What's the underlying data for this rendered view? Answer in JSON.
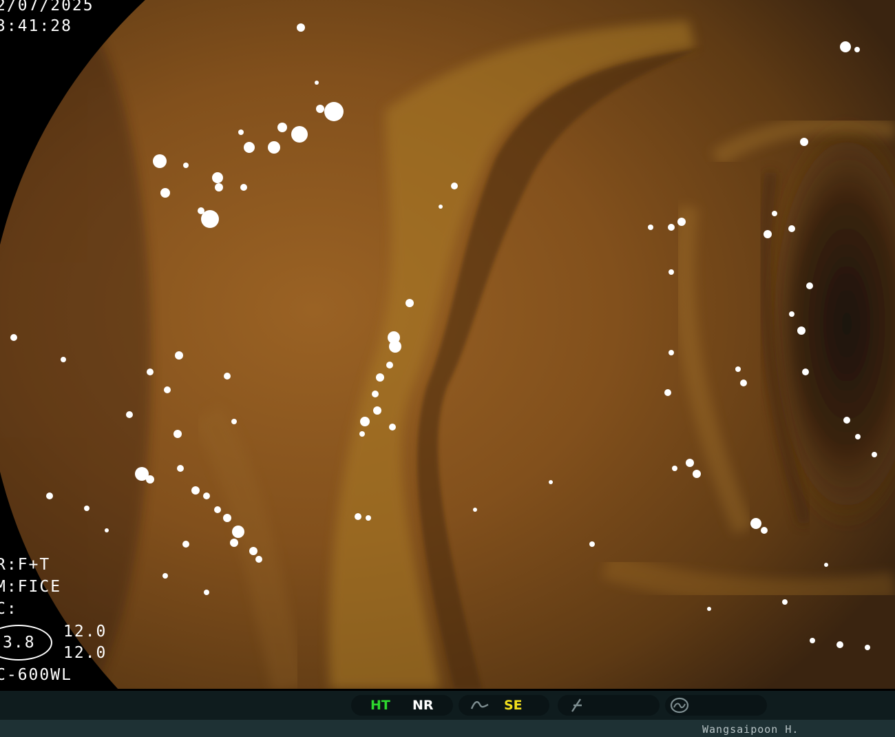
{
  "overlay": {
    "date": "2/07/2025",
    "time": "3:41:28",
    "mode_r": "R:F+T",
    "mode_m": "M:FICE",
    "mode_c": "C:",
    "oval_value": "3.8",
    "value_top": "12.0",
    "value_bottom": "12.0",
    "model": "C-600WL"
  },
  "status_bar": {
    "ht": "HT",
    "nr": "NR",
    "se": "SE",
    "icons": [
      "curve-icon",
      "slash-f-icon",
      "gauge-icon"
    ],
    "colors": {
      "ht": "#2ed82e",
      "nr": "#ffffff",
      "se": "#f2e01c",
      "icon": "#7f8f92"
    }
  },
  "operator": "Wangsaipoon H."
}
